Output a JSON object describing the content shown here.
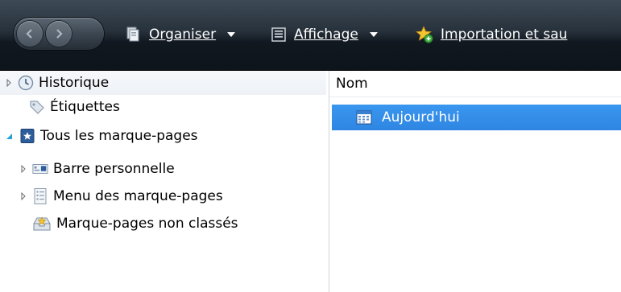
{
  "toolbar": {
    "organise_label": "Organiser",
    "view_label": "Affichage",
    "import_label": "Importation et sau"
  },
  "tree": [
    {
      "label": "Historique",
      "icon": "clock-icon",
      "twisty": "collapsed"
    },
    {
      "label": "Étiquettes",
      "icon": "tag-icon",
      "twisty": "none"
    },
    {
      "label": "Tous les marque-pages",
      "icon": "bookmark-star-icon",
      "twisty": "expanded"
    },
    {
      "label": "Barre personnelle",
      "icon": "toolbar-folder-icon",
      "twisty": "collapsed"
    },
    {
      "label": "Menu des marque-pages",
      "icon": "menu-folder-icon",
      "twisty": "collapsed"
    },
    {
      "label": "Marque-pages non classés",
      "icon": "unsorted-bookmarks-icon",
      "twisty": "none"
    }
  ],
  "list": {
    "column_name": "Nom",
    "rows": [
      {
        "label": "Aujourd'hui",
        "icon": "calendar-icon",
        "selected": true
      }
    ]
  },
  "colors": {
    "toolbar_dark": "#0d141b",
    "selection": "#3399ff"
  }
}
